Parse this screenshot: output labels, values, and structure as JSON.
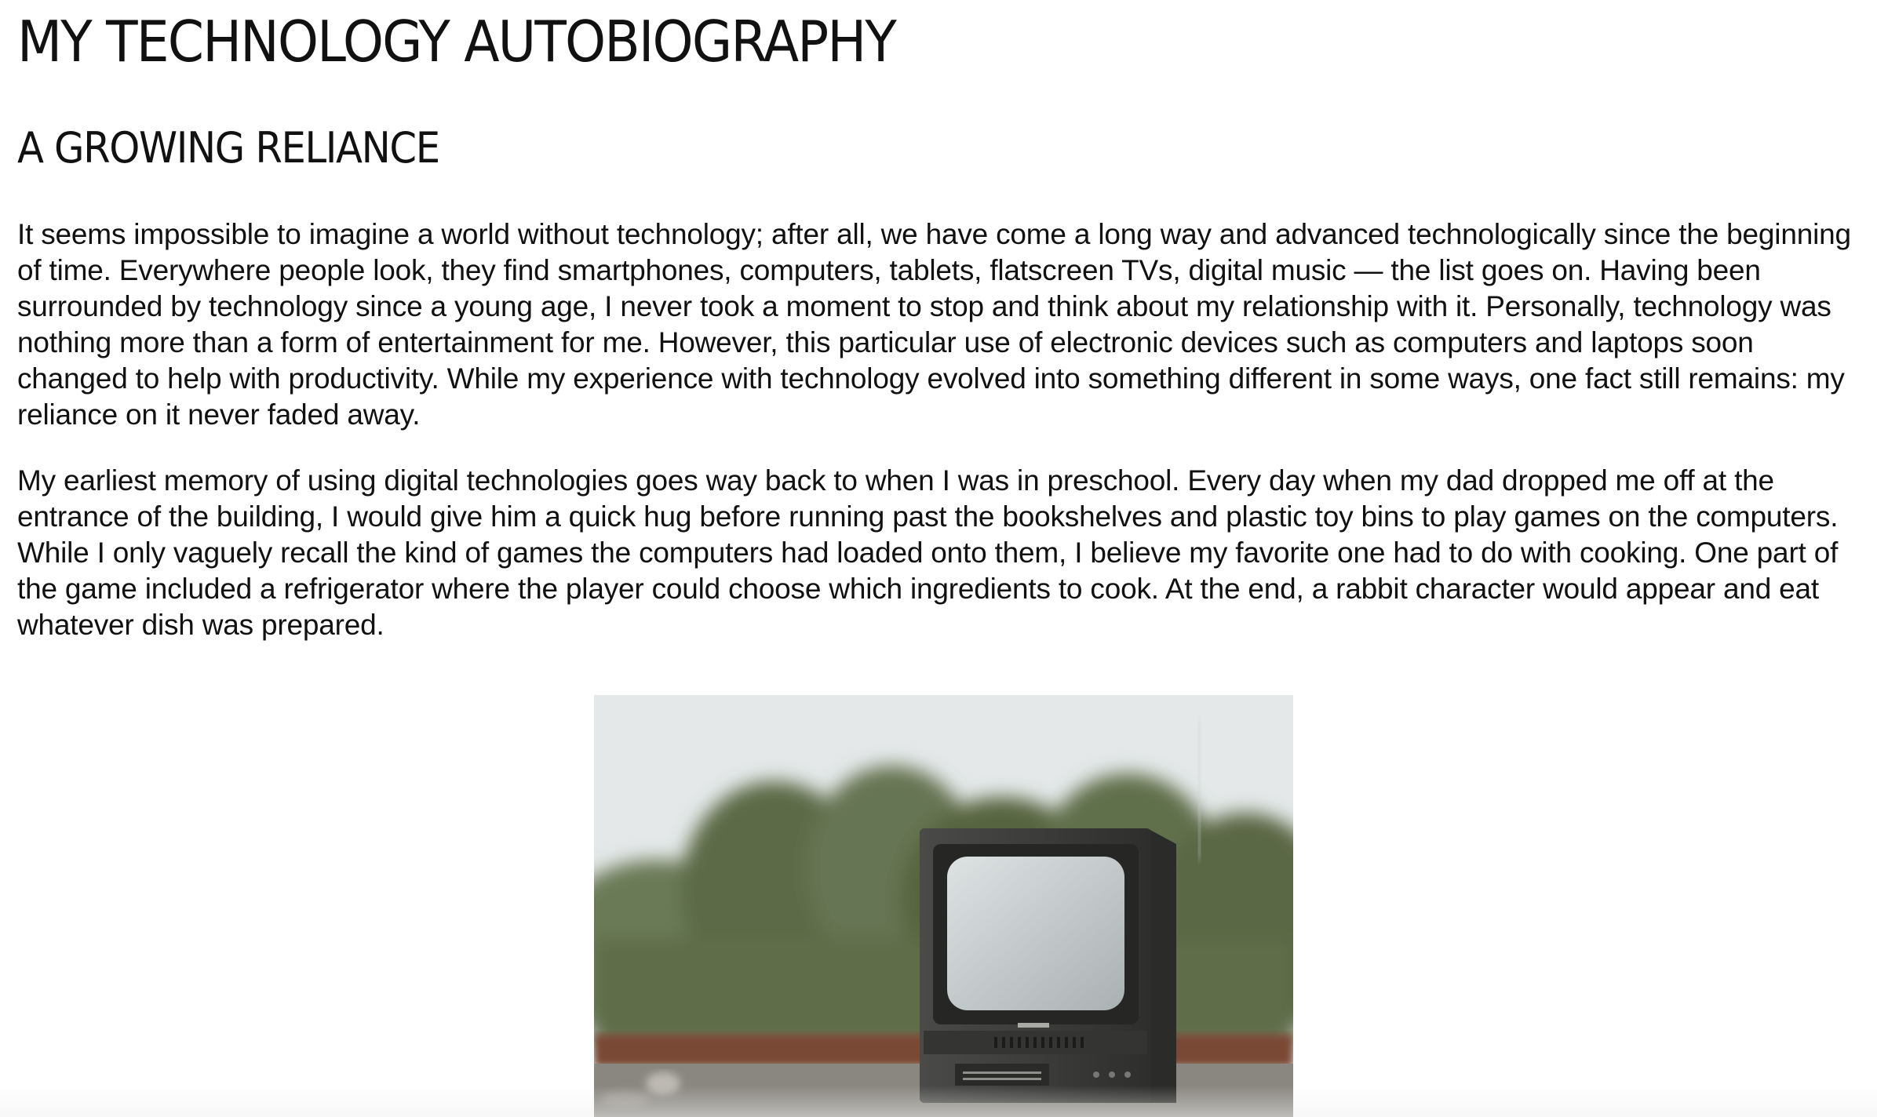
{
  "page": {
    "title": "MY TECHNOLOGY AUTOBIOGRAPHY",
    "section_heading": "A GROWING RELIANCE",
    "paragraphs": [
      "It seems impossible to imagine a world without technology; after all, we have come a long way and advanced technologically since the beginning of time. Everywhere people look, they find smartphones, computers, tablets, flatscreen TVs, digital music — the list goes on. Having been surrounded by technology since a young age, I never took a moment to stop and think about my relationship with it. Personally, technology was nothing more than a form of entertainment for me. However, this particular use of electronic devices such as computers and laptops soon changed to help with productivity. While my experience with technology evolved into something different in some ways, one fact still remains: my reliance on it never faded away.",
      "My earliest memory of using digital technologies goes way back to when I was in preschool. Every day when my dad dropped me off at the entrance of the building, I would give him a quick hug before running past the bookshelves and plastic toy bins to play games on the computers. While I only vaguely recall the kind of games the computers had loaded onto them, I believe my favorite one had to do with cooking. One part of the game included a refrigerator where the player could choose which ingredients to cook. At the end, a rabbit character would appear and eat whatever dish was prepared."
    ]
  },
  "image": {
    "subject": "old-crt-television-photo",
    "colors": {
      "sky": "#e4e8e9",
      "trees": "#5f6b48",
      "tv_body": "#3e3e3c",
      "screen": "#c9cfd0",
      "ledge": "#7a4a35",
      "ground": "#8a8780"
    }
  }
}
